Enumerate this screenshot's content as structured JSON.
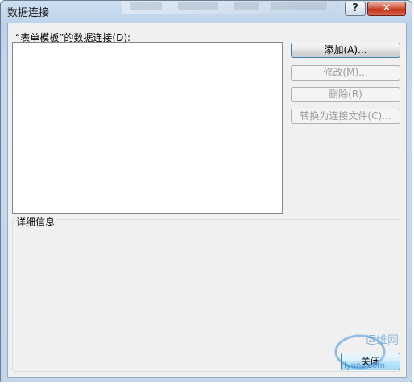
{
  "window": {
    "title": "数据连接",
    "help_label": "?",
    "close_label": "✕"
  },
  "list": {
    "label": "“表单模板”的数据连接(D):",
    "items": []
  },
  "buttons": {
    "add": "添加(A)...",
    "modify": "修改(M)...",
    "delete": "删除(R)",
    "convert": "转换为连接文件(C)..."
  },
  "details": {
    "title": "详细信息"
  },
  "footer": {
    "close": "关闭"
  },
  "watermark": {
    "text_cn": "运维网",
    "text_en": "iyunv.com"
  },
  "colors": {
    "accent": "#3c7fb1",
    "close_red": "#c4301a"
  }
}
